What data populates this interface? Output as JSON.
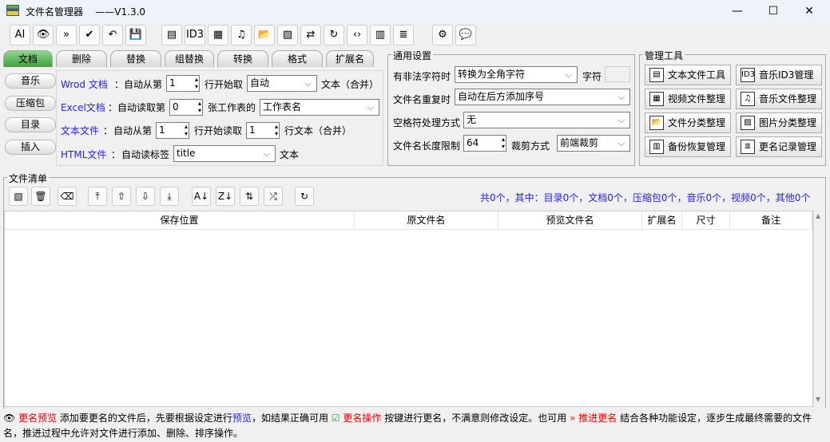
{
  "window": {
    "title": "文件名管理器",
    "version": "——V1.3.0",
    "minimize": "—",
    "maximize": "☐",
    "close": "✕"
  },
  "toolbar": [
    {
      "name": "ai-icon",
      "glyph": "AI"
    },
    {
      "name": "eye-preview-icon",
      "glyph": "👁"
    },
    {
      "name": "push-rename-icon",
      "glyph": "»"
    },
    {
      "name": "check-rename-icon",
      "glyph": "✔"
    },
    {
      "name": "undo-icon",
      "glyph": "↶"
    },
    {
      "name": "save-clock-icon",
      "glyph": "💾"
    },
    {
      "name": "text-file-icon",
      "glyph": "▤"
    },
    {
      "name": "id3-icon",
      "glyph": "ID3"
    },
    {
      "name": "video-file-icon",
      "glyph": "▦"
    },
    {
      "name": "music-file-icon",
      "glyph": "♫"
    },
    {
      "name": "folder-classify-icon",
      "glyph": "📂"
    },
    {
      "name": "image-classify-icon",
      "glyph": "▨"
    },
    {
      "name": "swap-icon",
      "glyph": "⇄"
    },
    {
      "name": "refresh-file-icon",
      "glyph": "↻"
    },
    {
      "name": "html-file-icon",
      "glyph": "‹›"
    },
    {
      "name": "backup-icon",
      "glyph": "▥"
    },
    {
      "name": "log-icon",
      "glyph": "≣"
    },
    {
      "name": "gear-icon",
      "glyph": "⚙"
    },
    {
      "name": "chat-icon",
      "glyph": "💬"
    }
  ],
  "tabs": [
    {
      "label": "文档",
      "active": true
    },
    {
      "label": "删除"
    },
    {
      "label": "替换"
    },
    {
      "label": "组替换"
    },
    {
      "label": "转换"
    },
    {
      "label": "格式"
    },
    {
      "label": "扩展名"
    }
  ],
  "side_tabs": [
    "音乐",
    "压缩包",
    "目录",
    "插入"
  ],
  "doc": {
    "word": {
      "label": "Wrod 文档",
      "colon": "：",
      "t1": "自动从第",
      "v1": "1",
      "t2": "行开始取",
      "sel": "自动",
      "t3": "文本（合并）"
    },
    "excel": {
      "label": "Excel文档",
      "colon": "：",
      "t1": "自动读取第",
      "v1": "0",
      "t2": "张工作表的",
      "sel": "工作表名"
    },
    "text": {
      "label": "文本文件",
      "colon": "：",
      "t1": "自动从第",
      "v1": "1",
      "t2": "行开始读取",
      "v2": "1",
      "t3": "行文本（合并）"
    },
    "html": {
      "label": "HTML文件",
      "colon": "：",
      "t1": "自动读标签",
      "sel": "title",
      "t3": "文本"
    }
  },
  "general": {
    "title": "通用设置",
    "illegal_label": "有非法字符时",
    "illegal_value": "转换为全角字符",
    "char_label": "字符",
    "char_value": "",
    "dup_label": "文件名重复时",
    "dup_value": "自动在后方添加序号",
    "space_label": "空格符处理方式",
    "space_value": "无",
    "len_label": "文件名长度限制",
    "len_value": "64",
    "trim_label": "裁剪方式",
    "trim_value": "前端裁剪"
  },
  "tools": {
    "title": "管理工具",
    "buttons": [
      {
        "label": "文本文件工具",
        "glyph": "▤"
      },
      {
        "label": "音乐ID3管理",
        "glyph": "ID3"
      },
      {
        "label": "视频文件整理",
        "glyph": "▦"
      },
      {
        "label": "音乐文件整理",
        "glyph": "♫"
      },
      {
        "label": "文件分类整理",
        "glyph": "📂"
      },
      {
        "label": "图片分类整理",
        "glyph": "▨"
      },
      {
        "label": "备份恢复管理",
        "glyph": "▥"
      },
      {
        "label": "更名记录管理",
        "glyph": "≣"
      }
    ]
  },
  "filelist": {
    "title": "文件清单",
    "toolbar": [
      {
        "name": "add-files-icon",
        "glyph": "▧"
      },
      {
        "name": "delete-icon",
        "glyph": "🗑"
      },
      {
        "name": "clear-icon",
        "glyph": "⌫"
      },
      {
        "name": "move-top-icon",
        "glyph": "⤒"
      },
      {
        "name": "move-up-icon",
        "glyph": "⇧"
      },
      {
        "name": "move-down-icon",
        "glyph": "⇩"
      },
      {
        "name": "move-bottom-icon",
        "glyph": "⤓"
      },
      {
        "name": "sort-az-icon",
        "glyph": "A↓"
      },
      {
        "name": "sort-za-icon",
        "glyph": "Z↓"
      },
      {
        "name": "reverse-icon",
        "glyph": "⇅"
      },
      {
        "name": "shuffle-icon",
        "glyph": "⤮"
      },
      {
        "name": "refresh-icon",
        "glyph": "↻"
      }
    ],
    "summary": "共0个，其中：目录0个，文档0个，压缩包0个，音乐0个，视频0个，其他0个",
    "columns": [
      "保存位置",
      "原文件名",
      "预览文件名",
      "扩展名",
      "尺寸",
      "备注"
    ]
  },
  "status": {
    "preview_label": "更名预览",
    "t1": "添加要更名的文件后，先要根据设定进行",
    "preview_link": "预览",
    "t2": "，如结果正确可用",
    "rename_label": "更名操作",
    "t3": "按键进行更名，不满意则修改设定。也可用",
    "push_label": "推进更名",
    "t4": "结合各种功能设定，逐步生成最终需要的文件名，推进过程中允许对文件进行添加、删除、排序操作。"
  },
  "colors": {
    "accent_tab": "#4caf50",
    "link_blue": "#2222ee",
    "status_red": "#e00000"
  }
}
